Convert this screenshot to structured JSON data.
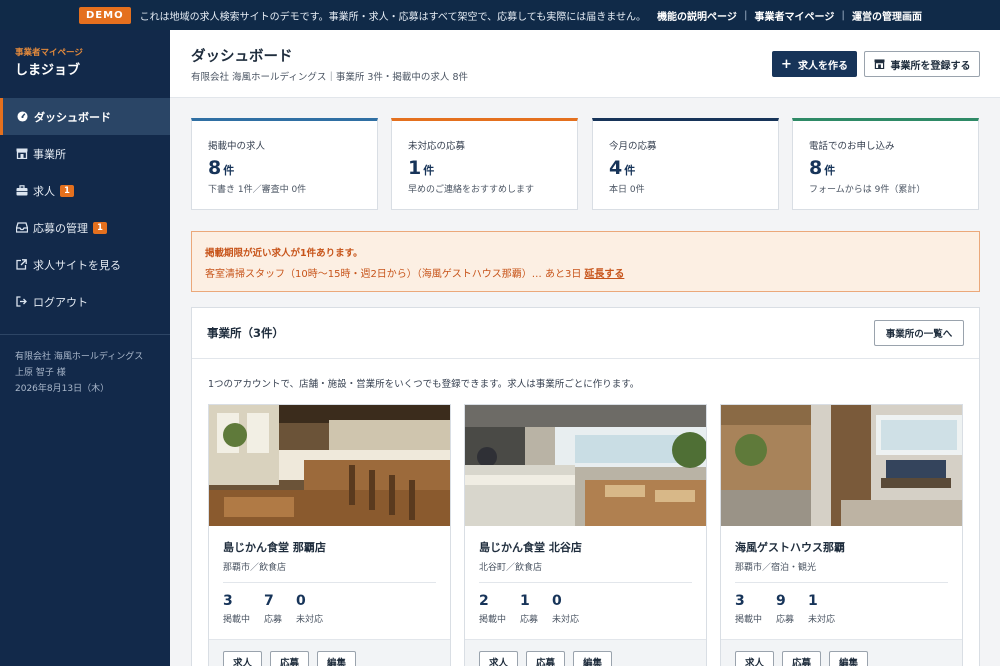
{
  "topbar": {
    "badge": "DEMO",
    "notice": "これは地域の求人検索サイトのデモです。事業所・求人・応募はすべて架空で、応募しても実際には届きません。",
    "links": [
      "機能の説明ページ",
      "事業者マイページ",
      "運営の管理画面"
    ],
    "separator": "|"
  },
  "sidebar": {
    "brand_sub": "事業者マイページ",
    "brand_name": "しまジョブ",
    "items": [
      {
        "label": "ダッシュボード",
        "icon": "dashboard-icon",
        "active": true
      },
      {
        "label": "事業所",
        "icon": "store-icon"
      },
      {
        "label": "求人",
        "icon": "briefcase-icon",
        "badge": "1"
      },
      {
        "label": "応募の管理",
        "icon": "inbox-icon",
        "badge": "1"
      },
      {
        "label": "求人サイトを見る",
        "icon": "external-link-icon"
      },
      {
        "label": "ログアウト",
        "icon": "logout-icon"
      }
    ],
    "company": "有限会社 海風ホールディングス",
    "user": "上原 智子 様",
    "date": "2026年8月13日（木）"
  },
  "header": {
    "title": "ダッシュボード",
    "subtitle": "有限会社 海風ホールディングス｜事業所 3件・掲載中の求人 8件",
    "create_job": "求人を作る",
    "create_job_icon": "+",
    "register_shop": "事業所を登録する"
  },
  "stats": [
    {
      "label": "掲載中の求人",
      "value": "8",
      "unit": "件",
      "note": "下書き 1件／審査中 0件",
      "color": "#2f6fa3"
    },
    {
      "label": "未対応の応募",
      "value": "1",
      "unit": "件",
      "note": "早めのご連絡をおすすめします",
      "color": "#e4701e"
    },
    {
      "label": "今月の応募",
      "value": "4",
      "unit": "件",
      "note": "本日 0件",
      "color": "#173459"
    },
    {
      "label": "電話でのお申し込み",
      "value": "8",
      "unit": "件",
      "note": "フォームからは 9件（累計）",
      "color": "#2e8a66"
    }
  ],
  "alert": {
    "title": "掲載期限が近い求人が1件あります。",
    "text": "客室清掃スタッフ（10時〜15時・週2日から）（海風ゲストハウス那覇）… あと3日",
    "link": "延長する"
  },
  "shops_panel": {
    "title": "事業所（3件）",
    "list_button": "事業所の一覧へ",
    "description": "1つのアカウントで、店舗・施設・営業所をいくつでも登録できます。求人は事業所ごとに作ります。",
    "stat_labels": [
      "掲載中",
      "応募",
      "未対応"
    ],
    "actions": [
      "求人",
      "応募",
      "編集"
    ],
    "shops": [
      {
        "name": "島じかん食堂 那覇店",
        "area": "那覇市／飲食店",
        "stats": [
          "3",
          "7",
          "0"
        ]
      },
      {
        "name": "島じかん食堂 北谷店",
        "area": "北谷町／飲食店",
        "stats": [
          "2",
          "1",
          "0"
        ]
      },
      {
        "name": "海風ゲストハウス那覇",
        "area": "那覇市／宿泊・観光",
        "stats": [
          "3",
          "9",
          "1"
        ]
      }
    ]
  }
}
